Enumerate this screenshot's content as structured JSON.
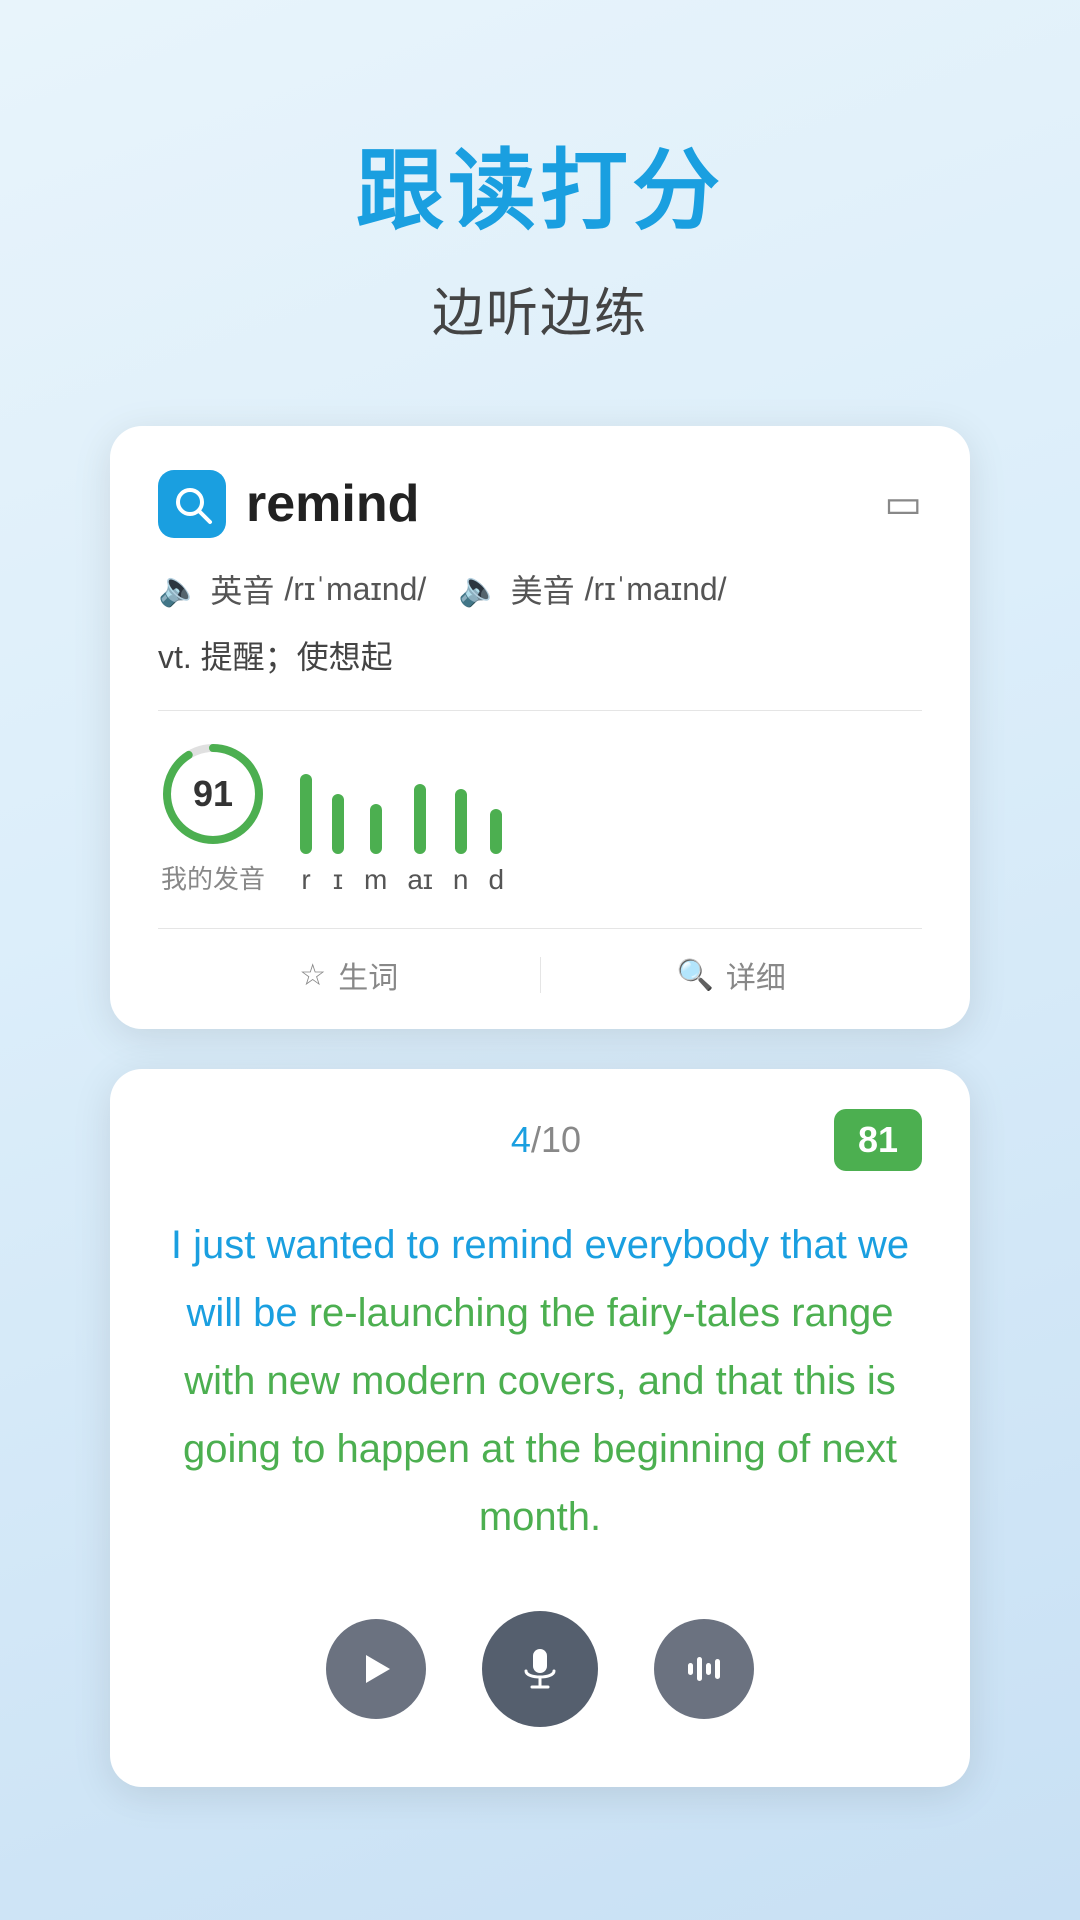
{
  "page": {
    "title": "跟读打分",
    "subtitle": "边听边练"
  },
  "dict_card": {
    "word": "remind",
    "phonetic_uk_label": "英音",
    "phonetic_uk": "/rɪˈmaɪnd/",
    "phonetic_us_label": "美音",
    "phonetic_us": "/rɪˈmaɪnd/",
    "definition": "vt. 提醒；使想起",
    "score": "91",
    "score_my_label": "我的发音",
    "phonemes": [
      "r",
      "ɪ",
      "m",
      "aɪ",
      "n",
      "d"
    ],
    "phoneme_heights": [
      80,
      60,
      50,
      70,
      65,
      45
    ],
    "action_vocab": "生词",
    "action_detail": "详细"
  },
  "reading_card": {
    "progress_current": "4",
    "progress_total": "10",
    "score_badge": "81",
    "sentence_text_blue": "I just wanted to remind everybody that we will be ",
    "sentence_text_green_1": "re-launching the fairy-tales ",
    "sentence_text_blue_2": "range with new modern covers, and that this is going to happen at the beginning of next month.",
    "full_sentence": "I just wanted to remind everybody that we will be re-launching the fairy-tales range with new modern covers, and that this is going to happen at the beginning of next month."
  },
  "controls": {
    "play_label": "play",
    "mic_label": "microphone",
    "wave_label": "sound-wave"
  }
}
